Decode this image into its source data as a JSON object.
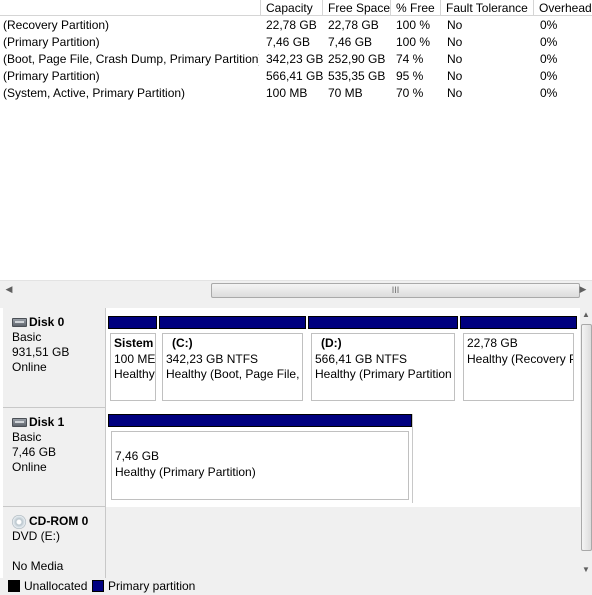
{
  "columns": [
    "Capacity",
    "Free Space",
    "% Free",
    "Fault Tolerance",
    "Overhead"
  ],
  "volumes": [
    {
      "status": "(Recovery Partition)",
      "capacity": "22,78 GB",
      "free": "22,78 GB",
      "pct": "100 %",
      "fault": "No",
      "overhead": "0%"
    },
    {
      "status": "(Primary Partition)",
      "capacity": "7,46 GB",
      "free": "7,46 GB",
      "pct": "100 %",
      "fault": "No",
      "overhead": "0%"
    },
    {
      "status": "(Boot, Page File, Crash Dump, Primary Partition)",
      "capacity": "342,23 GB",
      "free": "252,90 GB",
      "pct": "74 %",
      "fault": "No",
      "overhead": "0%"
    },
    {
      "status": "(Primary Partition)",
      "capacity": "566,41 GB",
      "free": "535,35 GB",
      "pct": "95 %",
      "fault": "No",
      "overhead": "0%"
    },
    {
      "status": "(System, Active, Primary Partition)",
      "capacity": "100 MB",
      "free": "70 MB",
      "pct": "70 %",
      "fault": "No",
      "overhead": "0%"
    }
  ],
  "hscroll_grip": "III",
  "disks": [
    {
      "name": "Disk 0",
      "type": "Basic",
      "size": "931,51 GB",
      "state": "Online",
      "partitions": [
        {
          "name": "Sistem",
          "line2": "100 ME",
          "line3": "Healthy"
        },
        {
          "name": "(C:)",
          "line2": "342,23 GB NTFS",
          "line3": "Healthy (Boot, Page File,"
        },
        {
          "name": "(D:)",
          "line2": "566,41 GB NTFS",
          "line3": "Healthy (Primary Partition"
        },
        {
          "name": "",
          "line2": "22,78 GB",
          "line3": "Healthy (Recovery P"
        }
      ]
    },
    {
      "name": "Disk 1",
      "type": "Basic",
      "size": "7,46 GB",
      "state": "Online",
      "partitions": [
        {
          "name": "",
          "line2": "7,46 GB",
          "line3": "Healthy (Primary Partition)"
        }
      ]
    },
    {
      "name": "CD-ROM 0",
      "type": "DVD (E:)",
      "size": "",
      "state": "No Media",
      "partitions": []
    }
  ],
  "legend": [
    {
      "label": "Unallocated",
      "color": "#000000"
    },
    {
      "label": "Primary partition",
      "color": "#00007f"
    }
  ],
  "icons": {
    "disk": "hard-disk-icon",
    "cdrom": "cd-rom-icon",
    "scroll_left": "arrow-left-icon",
    "scroll_right": "arrow-right-icon",
    "scroll_up": "arrow-up-icon",
    "scroll_down": "arrow-down-icon"
  }
}
